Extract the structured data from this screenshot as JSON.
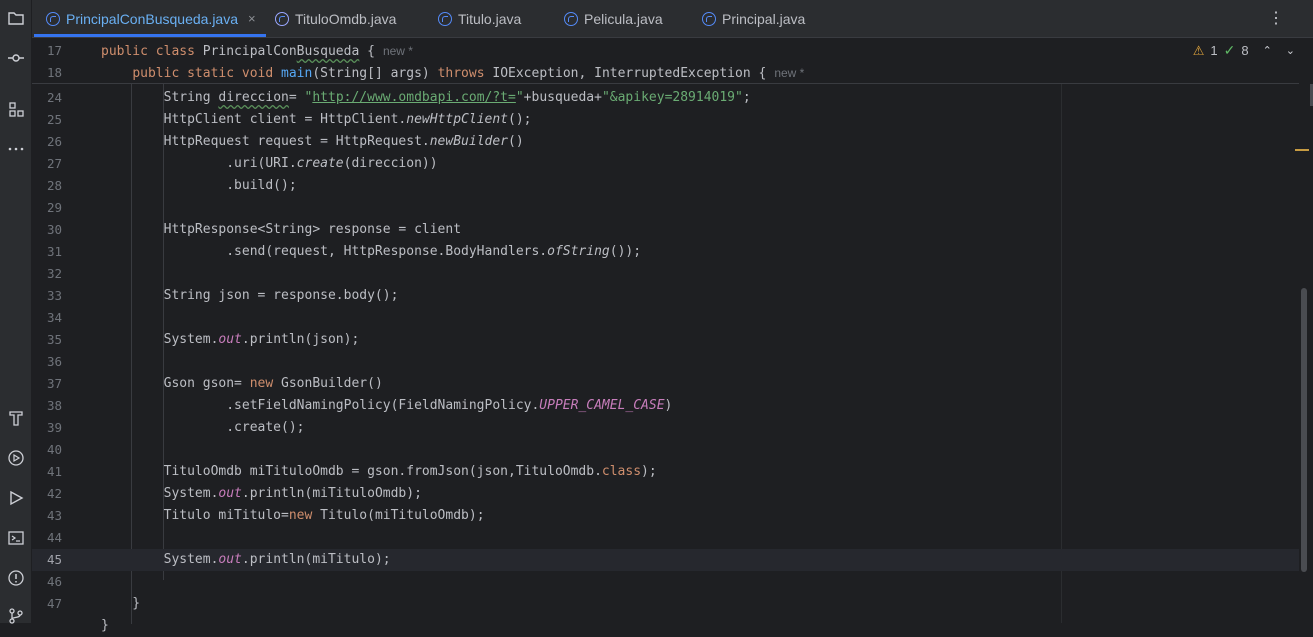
{
  "tabs": [
    {
      "label": "PrincipalConBusqueda.java",
      "active": true,
      "icon": "java-class-icon"
    },
    {
      "label": "TituloOmdb.java",
      "active": false,
      "icon": "java-record-icon"
    },
    {
      "label": "Titulo.java",
      "active": false,
      "icon": "java-class-icon"
    },
    {
      "label": "Pelicula.java",
      "active": false,
      "icon": "java-class-icon"
    },
    {
      "label": "Principal.java",
      "active": false,
      "icon": "java-class-icon"
    }
  ],
  "tab_close": "×",
  "tab_menu": "⋮",
  "inspections": {
    "warnings": "1",
    "weak_warnings": "8"
  },
  "hint_new": "new *",
  "toolstrip_icons": [
    "folder-icon",
    "commit-icon",
    "structure-icon",
    "more-icon",
    "build-icon",
    "services-icon",
    "run-icon",
    "terminal-icon",
    "problems-icon",
    "git-icon"
  ],
  "lines": {
    "l17": "17",
    "l18": "18",
    "l24": "24",
    "l25": "25",
    "l26": "26",
    "l27": "27",
    "l28": "28",
    "l29": "29",
    "l30": "30",
    "l31": "31",
    "l32": "32",
    "l33": "33",
    "l34": "34",
    "l35": "35",
    "l36": "36",
    "l37": "37",
    "l38": "38",
    "l39": "39",
    "l40": "40",
    "l41": "41",
    "l42": "42",
    "l43": "43",
    "l44": "44",
    "l45": "45",
    "l46": "46",
    "l47": "47"
  },
  "code": {
    "url": "http://www.omdbapi.com/?t=",
    "apikey": "\"&apikey=28914019\""
  },
  "colors": {
    "background": "#1e1f22",
    "keyword": "#cf8e6d",
    "string": "#6aab73",
    "field": "#c77dbb",
    "accent": "#3574f0"
  }
}
